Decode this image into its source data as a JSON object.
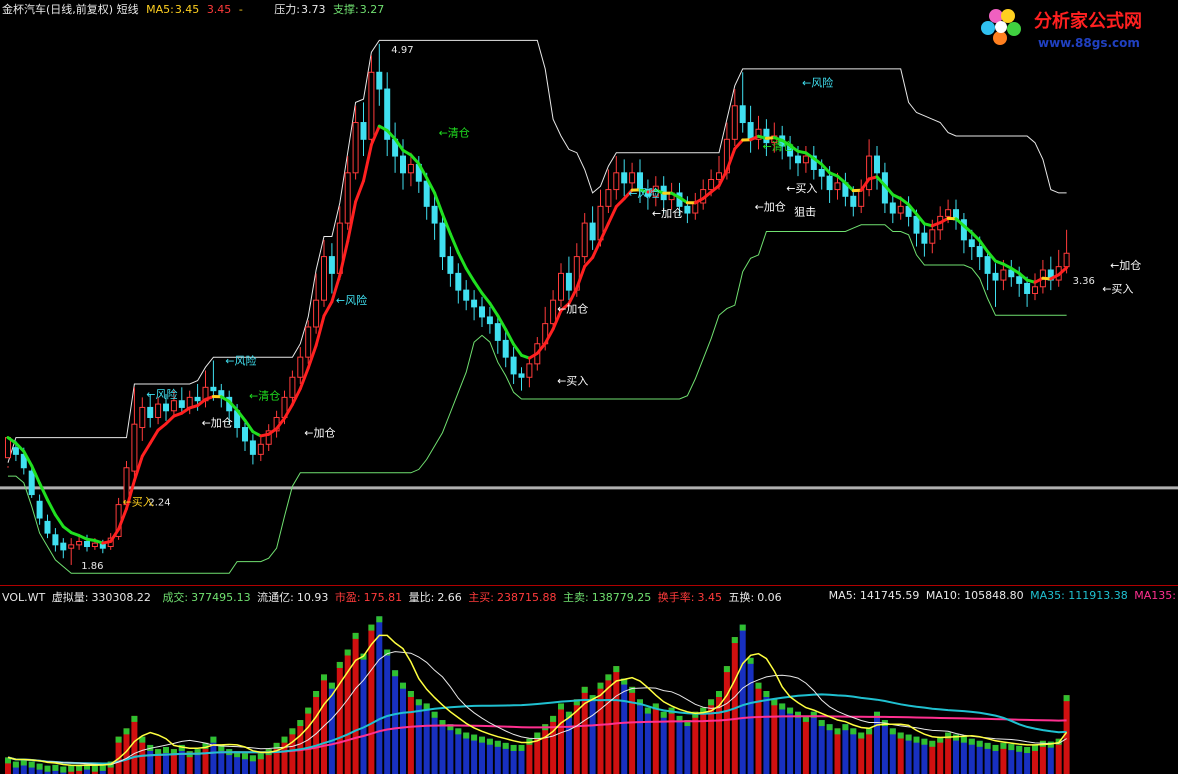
{
  "header": {
    "title": "金杯汽车(日线,前复权) 短线",
    "ma5_label": "MA5:",
    "ma5_value1": "3.45",
    "ma5_value2": "3.45",
    "ma5_dash": "-",
    "pressure_label": "压力:",
    "pressure_value": "3.73",
    "support_label": "支撑:",
    "support_value": "3.27"
  },
  "logo": {
    "name": "分析家公式网",
    "url": "www.88gs.com"
  },
  "volume_header": {
    "indicator": "VOL.WT",
    "virtual_label": "虚拟量:",
    "virtual_value": "330308.22",
    "deal_label": "成交:",
    "deal_value": "377495.13",
    "float_label": "流通亿:",
    "float_value": "10.93",
    "pe_label": "市盈:",
    "pe_value": "175.81",
    "ratio_label": "量比:",
    "ratio_value": "2.66",
    "buy_label": "主买:",
    "buy_value": "238715.88",
    "sell_label": "主卖:",
    "sell_value": "138779.25",
    "turnover_label": "换手率:",
    "turnover_value": "3.45",
    "five_label": "五换:",
    "five_value": "0.06",
    "ma5": "MA5: 141745.59",
    "ma10": "MA10: 105848.80",
    "ma35": "MA35: 111913.38",
    "ma135": "MA135:"
  },
  "colors": {
    "up": "#ff3b3b",
    "down": "#40e0f0",
    "trend_up": "#ff2020",
    "trend_down": "#20e020",
    "trend_turn": "#ffd020",
    "upper_band": "#e8e8e8",
    "lower_band": "#70e070",
    "vol_ma5": "#ffff40",
    "vol_ma10": "#e8e8e8",
    "vol_ma35": "#20c0d0",
    "vol_ma135": "#ff3090"
  },
  "chart_data": {
    "type": "candlestick",
    "price_markers": {
      "high": "4.97",
      "low": "1.86",
      "level": "2.24",
      "right": "3.36"
    },
    "price_range": [
      1.8,
      5.1
    ],
    "base_line": 2.32,
    "annotations": [
      {
        "text": "←风险",
        "i": 17,
        "price": 2.88,
        "color": "#40e0f0"
      },
      {
        "text": "←风险",
        "i": 27,
        "price": 3.08,
        "color": "#40e0f0"
      },
      {
        "text": "←清仓",
        "i": 30,
        "price": 2.87,
        "color": "#20e020"
      },
      {
        "text": "←加仓",
        "i": 24,
        "price": 2.71,
        "color": "#ffffff"
      },
      {
        "text": "←加仓",
        "i": 37,
        "price": 2.65,
        "color": "#ffffff"
      },
      {
        "text": "←风险",
        "i": 41,
        "price": 3.44,
        "color": "#40e0f0"
      },
      {
        "text": "←清仓",
        "i": 54,
        "price": 4.44,
        "color": "#20e020"
      },
      {
        "text": "←加仓",
        "i": 69,
        "price": 3.39,
        "color": "#ffffff"
      },
      {
        "text": "←买入",
        "i": 69,
        "price": 2.96,
        "color": "#ffffff"
      },
      {
        "text": "←风险",
        "i": 78,
        "price": 4.08,
        "color": "#40e0f0"
      },
      {
        "text": "←加仓",
        "i": 81,
        "price": 3.96,
        "color": "#ffffff"
      },
      {
        "text": "←清仓",
        "i": 95,
        "price": 4.36,
        "color": "#20e020"
      },
      {
        "text": "←买入",
        "i": 98,
        "price": 4.11,
        "color": "#ffffff"
      },
      {
        "text": "←加仓",
        "i": 94,
        "price": 4.0,
        "color": "#ffffff"
      },
      {
        "text": "狙击",
        "i": 99,
        "price": 3.97,
        "color": "#ffffff"
      },
      {
        "text": "←风险",
        "i": 100,
        "price": 4.74,
        "color": "#40e0f0"
      },
      {
        "text": "←加仓",
        "i": 139,
        "price": 3.65,
        "color": "#ffffff"
      },
      {
        "text": "←买入",
        "i": 138,
        "price": 3.51,
        "color": "#ffffff"
      },
      {
        "text": "←买入",
        "i": 14,
        "price": 2.24,
        "color": "#ffd020"
      }
    ],
    "candles": [
      [
        2.5,
        2.62,
        2.45,
        2.44
      ],
      [
        2.56,
        2.52,
        2.6,
        2.48
      ],
      [
        2.52,
        2.44,
        2.56,
        2.4
      ],
      [
        2.42,
        2.28,
        2.45,
        2.26
      ],
      [
        2.24,
        2.14,
        2.28,
        2.1
      ],
      [
        2.12,
        2.05,
        2.16,
        2.02
      ],
      [
        2.04,
        1.98,
        2.08,
        1.94
      ],
      [
        1.99,
        1.95,
        2.02,
        1.9
      ],
      [
        1.96,
        1.98,
        2.02,
        1.86
      ],
      [
        1.98,
        2.0,
        2.04,
        1.95
      ],
      [
        2.0,
        1.97,
        2.04,
        1.94
      ],
      [
        1.97,
        1.99,
        2.02,
        1.95
      ],
      [
        1.99,
        1.96,
        2.01,
        1.93
      ],
      [
        1.97,
        2.02,
        2.05,
        1.95
      ],
      [
        2.03,
        2.22,
        2.26,
        2.01
      ],
      [
        2.22,
        2.44,
        2.48,
        2.2
      ],
      [
        2.42,
        2.7,
        2.92,
        2.38
      ],
      [
        2.68,
        2.8,
        2.86,
        2.6
      ],
      [
        2.8,
        2.74,
        2.88,
        2.68
      ],
      [
        2.74,
        2.82,
        2.86,
        2.7
      ],
      [
        2.82,
        2.78,
        2.88,
        2.72
      ],
      [
        2.78,
        2.84,
        2.9,
        2.74
      ],
      [
        2.84,
        2.8,
        2.92,
        2.76
      ],
      [
        2.8,
        2.86,
        2.9,
        2.76
      ],
      [
        2.86,
        2.84,
        2.94,
        2.78
      ],
      [
        2.84,
        2.92,
        3.02,
        2.8
      ],
      [
        2.92,
        2.9,
        3.08,
        2.84
      ],
      [
        2.9,
        2.86,
        2.94,
        2.8
      ],
      [
        2.86,
        2.78,
        2.9,
        2.7
      ],
      [
        2.78,
        2.68,
        2.82,
        2.62
      ],
      [
        2.68,
        2.6,
        2.72,
        2.54
      ],
      [
        2.6,
        2.52,
        2.64,
        2.46
      ],
      [
        2.52,
        2.58,
        2.62,
        2.48
      ],
      [
        2.58,
        2.66,
        2.7,
        2.54
      ],
      [
        2.66,
        2.74,
        2.78,
        2.62
      ],
      [
        2.74,
        2.86,
        2.9,
        2.7
      ],
      [
        2.86,
        2.98,
        3.02,
        2.82
      ],
      [
        2.98,
        3.1,
        3.16,
        2.94
      ],
      [
        3.1,
        3.28,
        3.32,
        3.06
      ],
      [
        3.28,
        3.44,
        3.6,
        3.24
      ],
      [
        3.44,
        3.7,
        3.8,
        3.4
      ],
      [
        3.7,
        3.6,
        3.78,
        3.48
      ],
      [
        3.6,
        3.9,
        4.0,
        3.56
      ],
      [
        3.9,
        4.2,
        4.3,
        3.86
      ],
      [
        4.2,
        4.5,
        4.6,
        4.16
      ],
      [
        4.5,
        4.4,
        4.62,
        4.3
      ],
      [
        4.4,
        4.8,
        4.9,
        4.36
      ],
      [
        4.8,
        4.7,
        4.97,
        4.6
      ],
      [
        4.7,
        4.4,
        4.8,
        4.3
      ],
      [
        4.4,
        4.3,
        4.5,
        4.2
      ],
      [
        4.3,
        4.2,
        4.4,
        4.1
      ],
      [
        4.2,
        4.25,
        4.32,
        4.12
      ],
      [
        4.25,
        4.15,
        4.3,
        4.08
      ],
      [
        4.15,
        4.0,
        4.2,
        3.92
      ],
      [
        4.0,
        3.9,
        4.06,
        3.8
      ],
      [
        3.9,
        3.7,
        3.96,
        3.62
      ],
      [
        3.7,
        3.6,
        3.76,
        3.52
      ],
      [
        3.6,
        3.5,
        3.66,
        3.42
      ],
      [
        3.5,
        3.44,
        3.56,
        3.38
      ],
      [
        3.44,
        3.4,
        3.5,
        3.32
      ],
      [
        3.4,
        3.34,
        3.46,
        3.28
      ],
      [
        3.34,
        3.3,
        3.4,
        3.24
      ],
      [
        3.3,
        3.2,
        3.36,
        3.12
      ],
      [
        3.2,
        3.1,
        3.26,
        3.04
      ],
      [
        3.1,
        3.0,
        3.16,
        2.94
      ],
      [
        3.0,
        2.98,
        3.04,
        2.9
      ],
      [
        2.98,
        3.06,
        3.1,
        2.92
      ],
      [
        3.06,
        3.18,
        3.22,
        3.02
      ],
      [
        3.18,
        3.3,
        3.4,
        3.14
      ],
      [
        3.3,
        3.44,
        3.5,
        3.26
      ],
      [
        3.44,
        3.6,
        3.66,
        3.4
      ],
      [
        3.6,
        3.5,
        3.7,
        3.44
      ],
      [
        3.5,
        3.7,
        3.78,
        3.46
      ],
      [
        3.7,
        3.9,
        3.96,
        3.66
      ],
      [
        3.9,
        3.8,
        4.0,
        3.74
      ],
      [
        3.8,
        4.0,
        4.1,
        3.76
      ],
      [
        4.0,
        4.1,
        4.22,
        3.96
      ],
      [
        4.1,
        4.2,
        4.3,
        4.04
      ],
      [
        4.2,
        4.14,
        4.28,
        4.06
      ],
      [
        4.14,
        4.2,
        4.26,
        4.1
      ],
      [
        4.2,
        4.1,
        4.28,
        4.02
      ],
      [
        4.1,
        4.06,
        4.16,
        3.98
      ],
      [
        4.06,
        4.12,
        4.18,
        4.0
      ],
      [
        4.12,
        4.04,
        4.18,
        3.96
      ],
      [
        4.04,
        4.08,
        4.14,
        3.98
      ],
      [
        4.08,
        4.0,
        4.14,
        3.94
      ],
      [
        4.0,
        3.96,
        4.06,
        3.9
      ],
      [
        3.96,
        4.02,
        4.08,
        3.92
      ],
      [
        4.02,
        4.1,
        4.16,
        3.98
      ],
      [
        4.1,
        4.16,
        4.22,
        4.06
      ],
      [
        4.16,
        4.2,
        4.3,
        4.1
      ],
      [
        4.2,
        4.4,
        4.5,
        4.16
      ],
      [
        4.4,
        4.6,
        4.7,
        4.36
      ],
      [
        4.6,
        4.5,
        4.8,
        4.44
      ],
      [
        4.5,
        4.4,
        4.6,
        4.32
      ],
      [
        4.4,
        4.46,
        4.54,
        4.34
      ],
      [
        4.46,
        4.38,
        4.52,
        4.3
      ],
      [
        4.38,
        4.42,
        4.5,
        4.32
      ],
      [
        4.42,
        4.36,
        4.48,
        4.28
      ],
      [
        4.36,
        4.3,
        4.42,
        4.22
      ],
      [
        4.3,
        4.26,
        4.36,
        4.18
      ],
      [
        4.26,
        4.3,
        4.36,
        4.2
      ],
      [
        4.3,
        4.22,
        4.36,
        4.16
      ],
      [
        4.22,
        4.18,
        4.28,
        4.1
      ],
      [
        4.18,
        4.1,
        4.24,
        4.02
      ],
      [
        4.1,
        4.14,
        4.2,
        4.04
      ],
      [
        4.14,
        4.06,
        4.2,
        4.0
      ],
      [
        4.06,
        4.0,
        4.12,
        3.94
      ],
      [
        4.0,
        4.1,
        4.16,
        3.96
      ],
      [
        4.1,
        4.3,
        4.4,
        4.06
      ],
      [
        4.3,
        4.2,
        4.36,
        4.1
      ],
      [
        4.2,
        4.02,
        4.26,
        3.96
      ],
      [
        4.02,
        3.96,
        4.08,
        3.9
      ],
      [
        3.96,
        4.0,
        4.06,
        3.92
      ],
      [
        4.0,
        3.94,
        4.06,
        3.88
      ],
      [
        3.94,
        3.84,
        3.98,
        3.76
      ],
      [
        3.84,
        3.78,
        3.9,
        3.7
      ],
      [
        3.78,
        3.86,
        3.92,
        3.72
      ],
      [
        3.86,
        3.94,
        4.0,
        3.8
      ],
      [
        3.94,
        3.98,
        4.04,
        3.9
      ],
      [
        3.98,
        3.92,
        4.04,
        3.86
      ],
      [
        3.92,
        3.8,
        3.96,
        3.72
      ],
      [
        3.8,
        3.76,
        3.86,
        3.68
      ],
      [
        3.76,
        3.7,
        3.82,
        3.62
      ],
      [
        3.7,
        3.6,
        3.74,
        3.5
      ],
      [
        3.6,
        3.56,
        3.66,
        3.4
      ],
      [
        3.56,
        3.62,
        3.68,
        3.5
      ],
      [
        3.62,
        3.58,
        3.68,
        3.52
      ],
      [
        3.58,
        3.54,
        3.64,
        3.46
      ],
      [
        3.54,
        3.48,
        3.58,
        3.4
      ],
      [
        3.48,
        3.52,
        3.6,
        3.44
      ],
      [
        3.52,
        3.62,
        3.68,
        3.48
      ],
      [
        3.62,
        3.56,
        3.7,
        3.5
      ],
      [
        3.56,
        3.64,
        3.74,
        3.52
      ],
      [
        3.64,
        3.72,
        3.86,
        3.6
      ]
    ],
    "volume_range": [
      0,
      400000
    ],
    "volumes": [
      40000,
      30000,
      35000,
      30000,
      25000,
      20000,
      22000,
      18000,
      20000,
      22000,
      25000,
      20000,
      22000,
      30000,
      90000,
      110000,
      140000,
      90000,
      70000,
      60000,
      65000,
      60000,
      70000,
      55000,
      60000,
      75000,
      90000,
      70000,
      60000,
      55000,
      50000,
      45000,
      50000,
      60000,
      75000,
      90000,
      110000,
      130000,
      160000,
      200000,
      240000,
      220000,
      270000,
      300000,
      340000,
      290000,
      360000,
      380000,
      300000,
      250000,
      220000,
      200000,
      180000,
      170000,
      150000,
      130000,
      120000,
      110000,
      100000,
      95000,
      90000,
      85000,
      80000,
      75000,
      70000,
      70000,
      85000,
      100000,
      120000,
      140000,
      170000,
      150000,
      180000,
      210000,
      190000,
      220000,
      240000,
      260000,
      230000,
      210000,
      180000,
      160000,
      170000,
      150000,
      160000,
      140000,
      130000,
      150000,
      160000,
      180000,
      200000,
      260000,
      330000,
      360000,
      280000,
      220000,
      200000,
      180000,
      170000,
      160000,
      150000,
      140000,
      150000,
      130000,
      120000,
      110000,
      120000,
      110000,
      100000,
      110000,
      150000,
      130000,
      110000,
      100000,
      95000,
      90000,
      85000,
      80000,
      90000,
      100000,
      95000,
      90000,
      85000,
      80000,
      75000,
      70000,
      75000,
      72000,
      68000,
      65000,
      70000,
      80000,
      78000,
      85000,
      190000
    ]
  }
}
